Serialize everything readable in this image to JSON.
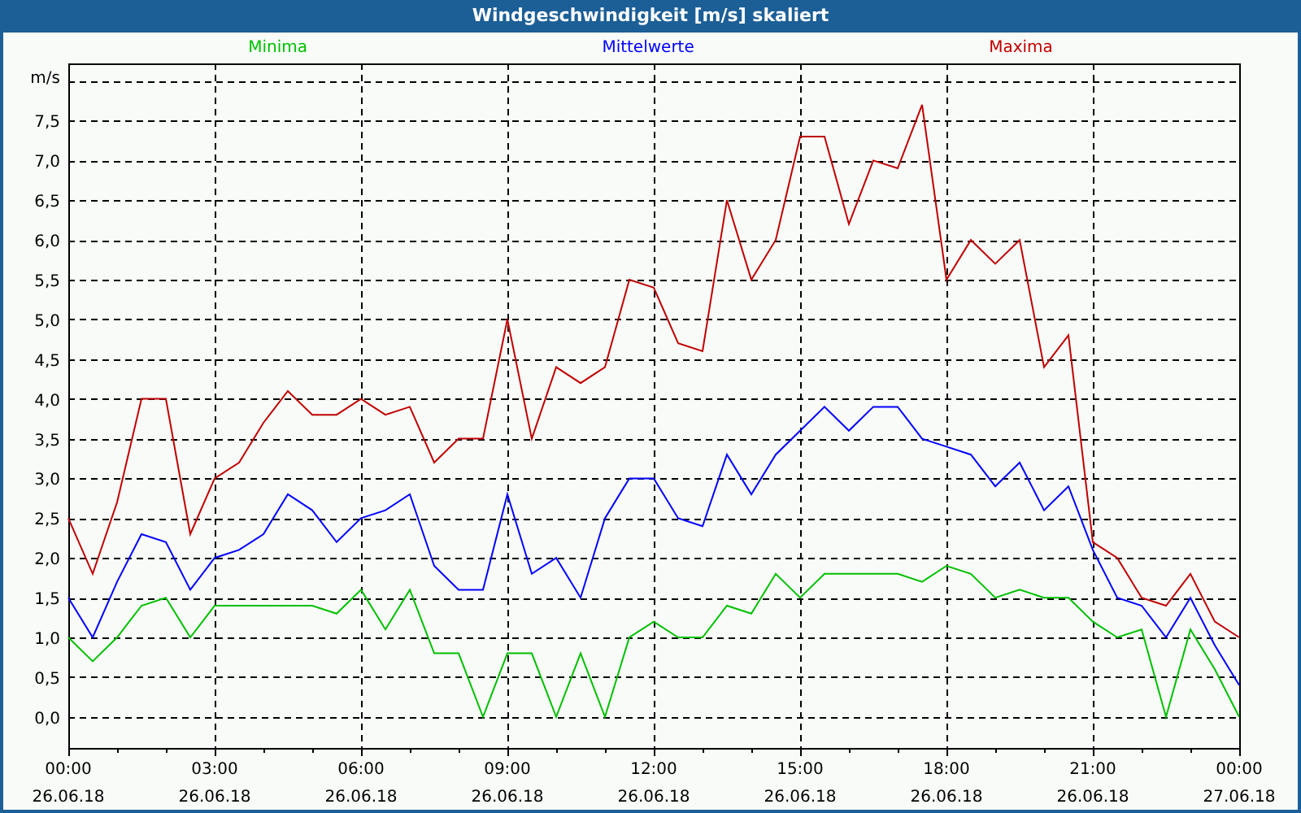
{
  "window": {
    "title": "Windgeschwindigkeit [m/s] skaliert"
  },
  "chart_data": {
    "type": "line",
    "ylabel": "m/s",
    "grid": true,
    "categories": [
      "00:00\n26.06.18",
      null,
      null,
      null,
      null,
      null,
      "03:00\n26.06.18",
      null,
      null,
      null,
      null,
      null,
      "06:00\n26.06.18",
      null,
      null,
      null,
      null,
      null,
      "09:00\n26.06.18",
      null,
      null,
      null,
      null,
      null,
      "12:00\n26.06.18",
      null,
      null,
      null,
      null,
      null,
      "15:00\n26.06.18",
      null,
      null,
      null,
      null,
      null,
      "18:00\n26.06.18",
      null,
      null,
      null,
      null,
      null,
      "21:00\n26.06.18",
      null,
      null,
      null,
      null,
      null,
      "00:00\n27.06.18"
    ],
    "series": [
      {
        "name": "Minima",
        "color": "#00c000",
        "values": [
          1.0,
          0.7,
          1.0,
          1.4,
          1.5,
          1.0,
          1.4,
          1.4,
          1.4,
          1.4,
          1.4,
          1.3,
          1.6,
          1.1,
          1.6,
          0.8,
          0.8,
          0.0,
          0.8,
          0.8,
          0.0,
          0.8,
          0.0,
          1.0,
          1.2,
          1.0,
          1.0,
          1.4,
          1.3,
          1.8,
          1.5,
          1.8,
          1.8,
          1.8,
          1.8,
          1.7,
          1.9,
          1.8,
          1.5,
          1.6,
          1.5,
          1.5,
          1.2,
          1.0,
          1.1,
          0.0,
          1.1,
          0.6,
          0.0
        ]
      },
      {
        "name": "Mittelwerte",
        "color": "#0000ff",
        "values": [
          1.5,
          1.0,
          1.7,
          2.3,
          2.2,
          1.6,
          2.0,
          2.1,
          2.3,
          2.8,
          2.6,
          2.2,
          2.5,
          2.6,
          2.8,
          1.9,
          1.6,
          1.6,
          2.8,
          1.8,
          2.0,
          1.5,
          2.5,
          3.0,
          3.0,
          2.5,
          2.4,
          3.3,
          2.8,
          3.3,
          3.6,
          3.9,
          3.6,
          3.9,
          3.9,
          3.5,
          3.4,
          3.3,
          2.9,
          3.2,
          2.6,
          2.9,
          2.1,
          1.5,
          1.4,
          1.0,
          1.5,
          0.9,
          0.4
        ]
      },
      {
        "name": "Maxima",
        "color": "#c00000",
        "values": [
          2.5,
          1.8,
          2.7,
          4.0,
          4.0,
          2.3,
          3.0,
          3.2,
          3.7,
          4.1,
          3.8,
          3.8,
          4.0,
          3.8,
          3.9,
          3.2,
          3.5,
          3.5,
          5.0,
          3.5,
          4.4,
          4.2,
          4.4,
          5.5,
          5.4,
          4.7,
          4.6,
          6.5,
          5.5,
          6.0,
          7.3,
          7.3,
          6.2,
          7.0,
          6.9,
          7.7,
          5.5,
          6.0,
          5.7,
          6.0,
          4.4,
          4.8,
          2.2,
          2.0,
          1.5,
          1.4,
          1.8,
          1.2,
          1.0
        ]
      }
    ],
    "ylim": [
      -0.39,
      8.22
    ],
    "yticks": [
      {
        "value": 0,
        "label": "0,0"
      },
      {
        "value": 0.5,
        "label": "0,5"
      },
      {
        "value": 1,
        "label": "1,0"
      },
      {
        "value": 1.5,
        "label": "1,5"
      },
      {
        "value": 2,
        "label": "2,0"
      },
      {
        "value": 2.5,
        "label": "2,5"
      },
      {
        "value": 3,
        "label": "3,0"
      },
      {
        "value": 3.5,
        "label": "3,5"
      },
      {
        "value": 4,
        "label": "4,0"
      },
      {
        "value": 4.5,
        "label": "4,5"
      },
      {
        "value": 5,
        "label": "5,0"
      },
      {
        "value": 5.5,
        "label": "5,5"
      },
      {
        "value": 6,
        "label": "6,0"
      },
      {
        "value": 6.5,
        "label": "6,5"
      },
      {
        "value": 7,
        "label": "7,0"
      },
      {
        "value": 7.5,
        "label": "7,5"
      }
    ]
  }
}
